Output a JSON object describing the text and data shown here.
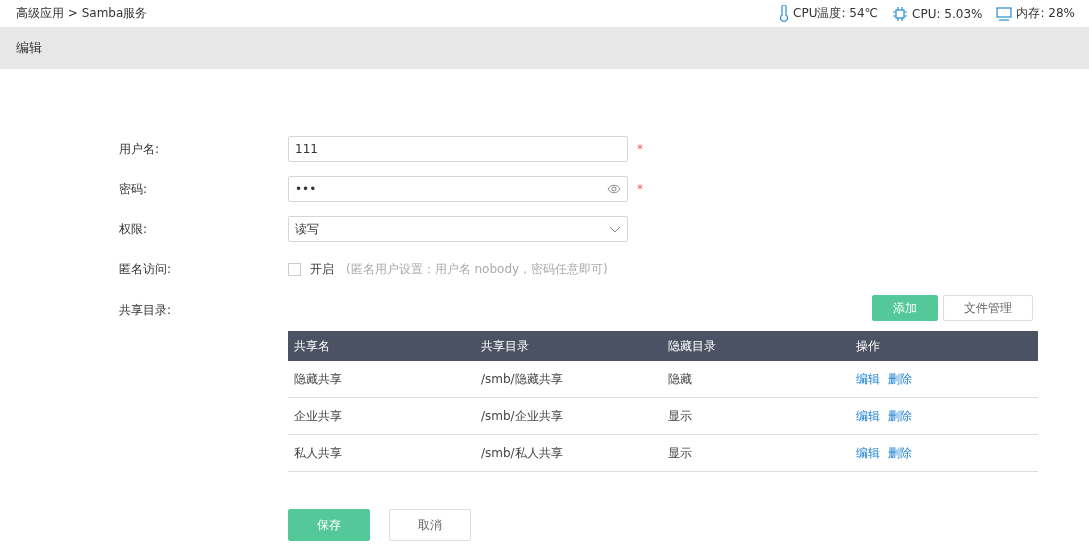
{
  "breadcrumb": "高级应用 > Samba服务",
  "status": [
    {
      "kind": "temp",
      "text": "CPU温度: 54℃"
    },
    {
      "kind": "cpu",
      "text": "CPU: 5.03%"
    },
    {
      "kind": "memory",
      "text": "内存: 28%"
    }
  ],
  "header": {
    "title": "编辑"
  },
  "form": {
    "username": {
      "label": "用户名:",
      "value": "111",
      "required_mark": "*"
    },
    "password": {
      "label": "密码:",
      "value": "•••",
      "required_mark": "*"
    },
    "permission": {
      "label": "权限:",
      "value": "读写"
    },
    "anonymous": {
      "label": "匿名访问:",
      "checked": false,
      "option": "开启",
      "hint": "(匿名用户设置：用户名 nobody，密码任意即可)"
    },
    "shares": {
      "label": "共享目录:",
      "buttons": [
        "添加",
        "文件管理"
      ],
      "columns": [
        "共享名",
        "共享目录",
        "隐藏目录",
        "操作"
      ],
      "rows": [
        {
          "name": "隐藏共享",
          "path": "/smb/隐藏共享",
          "visibility": "隐藏",
          "actions": [
            "编辑",
            "删除"
          ]
        },
        {
          "name": "企业共享",
          "path": "/smb/企业共享",
          "visibility": "显示",
          "actions": [
            "编辑",
            "删除"
          ]
        },
        {
          "name": "私人共享",
          "path": "/smb/私人共享",
          "visibility": "显示",
          "actions": [
            "编辑",
            "删除"
          ]
        }
      ]
    }
  },
  "footer": {
    "save": "保存",
    "cancel": "取消"
  }
}
